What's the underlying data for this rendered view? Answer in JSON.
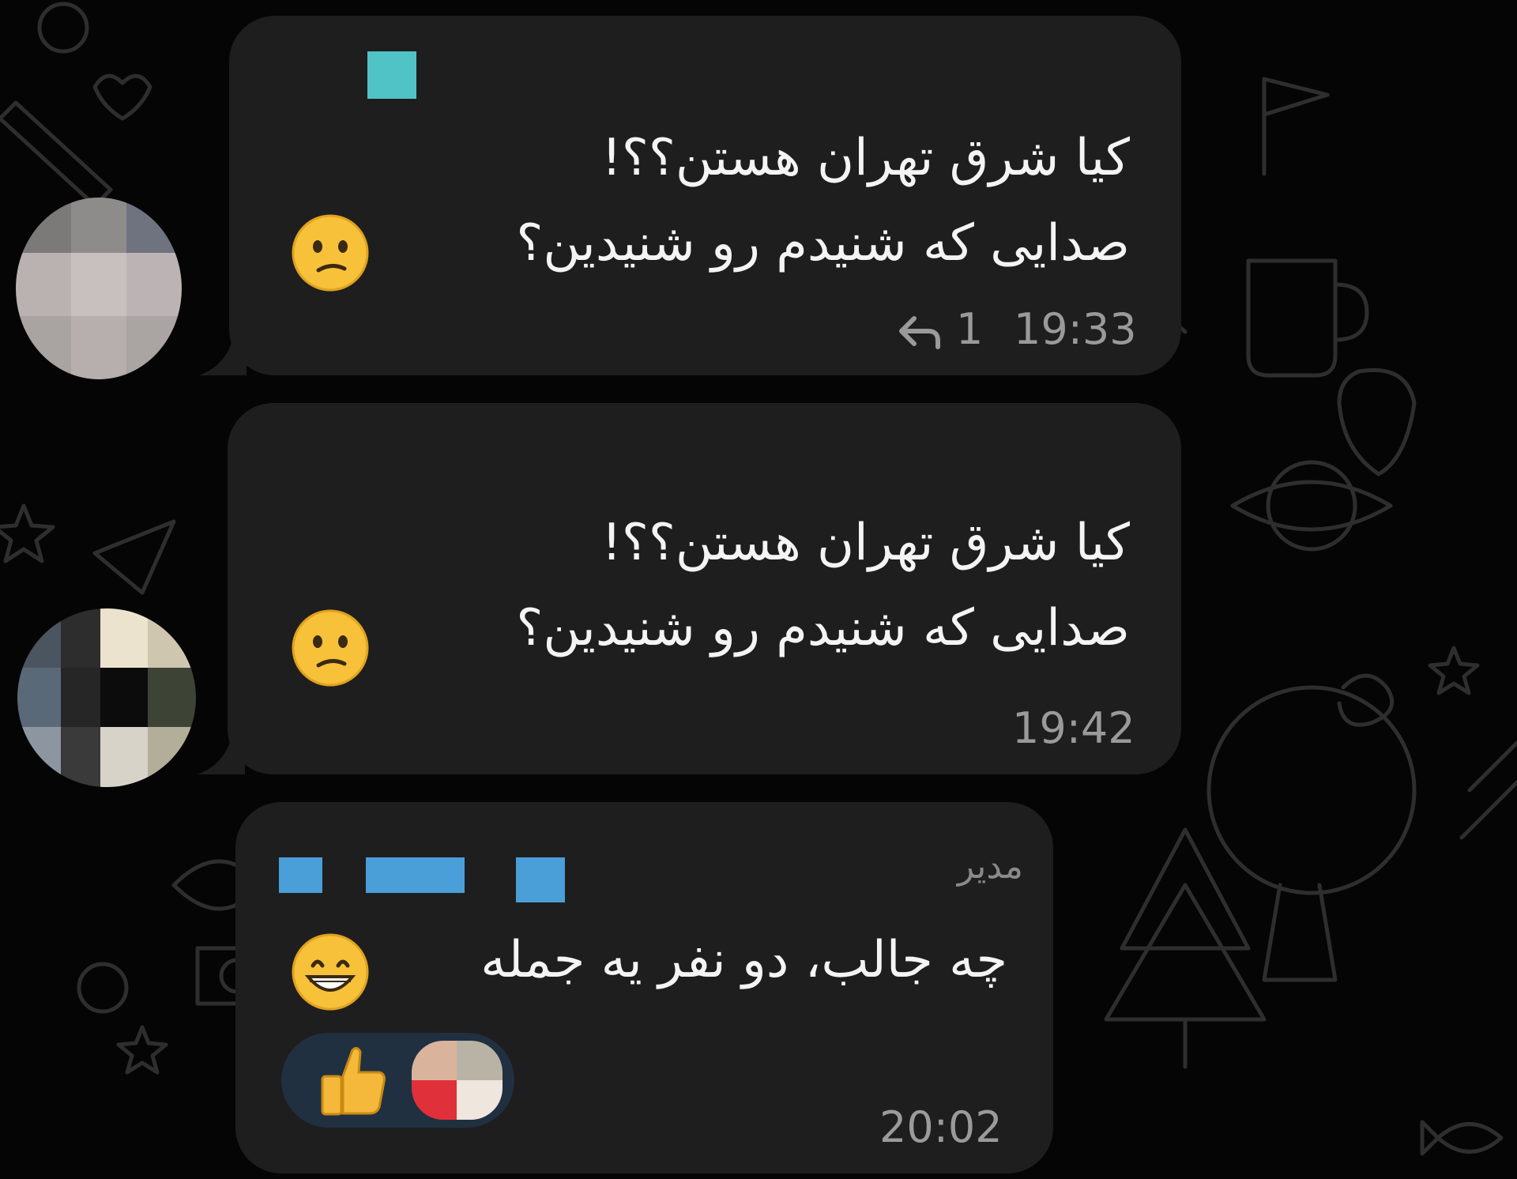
{
  "colors": {
    "background": "#050505",
    "bubble": "#1e1e1f",
    "text": "#f4f4f4",
    "meta": "#9a9a9a",
    "accent_teal": "#4fc3c5",
    "accent_blue": "#4a9fd8",
    "reaction_pill": "#203041"
  },
  "messages": [
    {
      "line1": "کیا شرق تهران هستن؟؟!",
      "line2": "صدایی که شنیدم رو شنیدین؟",
      "emoji": "confused-face-icon",
      "reply_count": "1",
      "time": "19:33"
    },
    {
      "line1": "کیا شرق تهران هستن؟؟!",
      "line2": "صدایی که شنیدم رو شنیدین؟",
      "emoji": "confused-face-icon",
      "time": "19:42"
    },
    {
      "role": "مدیر",
      "line1": "چه جالب، دو نفر یه جمله",
      "emoji": "grinning-face-icon",
      "reaction": "thumbs-up-icon",
      "time": "20:02"
    }
  ]
}
